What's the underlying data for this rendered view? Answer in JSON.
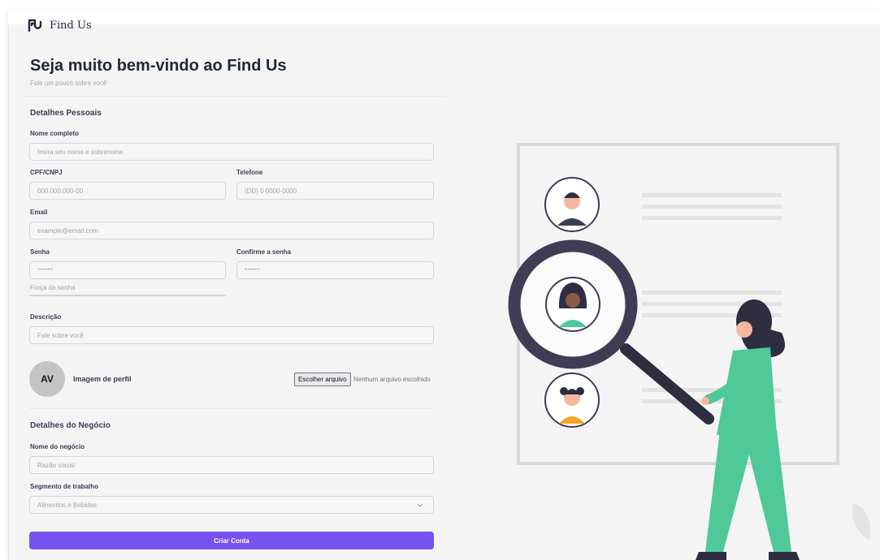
{
  "brand": {
    "name": "Find Us",
    "logo_icon": "find-us-logo-icon"
  },
  "header": {
    "title": "Seja muito bem-vindo ao Find Us",
    "subtitle": "Fale um pouco sobre você"
  },
  "personal": {
    "section_title": "Detalhes Pessoais",
    "full_name": {
      "label": "Nome completo",
      "placeholder": "Insira seu nome e sobrenome"
    },
    "cpf": {
      "label": "CPF/CNPJ",
      "placeholder": "000.000.000-00"
    },
    "phone": {
      "label": "Telefone",
      "placeholder": "(DD) 0 0000-0000"
    },
    "email": {
      "label": "Email",
      "placeholder": "example@email.com"
    },
    "password": {
      "label": "Senha",
      "placeholder": "******"
    },
    "confirm_password": {
      "label": "Confirme a senha",
      "placeholder": "******"
    },
    "password_strength": {
      "label": "Força da senha",
      "value": 0
    },
    "description": {
      "label": "Descrição",
      "placeholder": "Fale sobre você"
    },
    "profile_image": {
      "initials": "AV",
      "label": "Imagem de perfil",
      "button_label": "Escolher arquivo",
      "status": "Nenhum arquivo escolhido"
    }
  },
  "business": {
    "section_title": "Detalhes do Negócio",
    "business_name": {
      "label": "Nome do negócio",
      "placeholder": "Razão social"
    },
    "segment": {
      "label": "Segmento de trabalho",
      "selected": "Alimentos e Bebidas",
      "icon": "chevron-down-icon"
    }
  },
  "submit_label": "Criar Conta",
  "colors": {
    "accent": "#7752f0",
    "illustration_green": "#4fc89a",
    "illustration_dark": "#3f3d56"
  }
}
